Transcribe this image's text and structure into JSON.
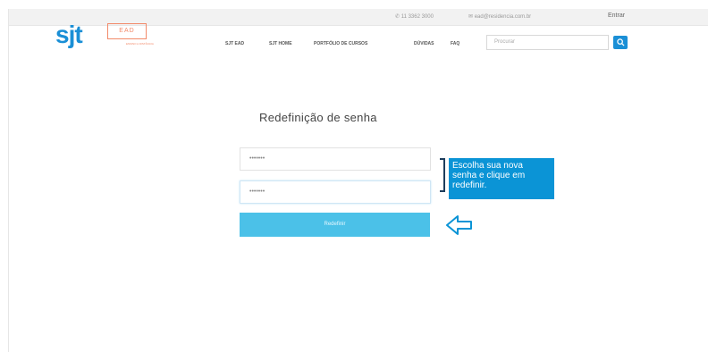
{
  "topbar": {
    "phone": "11 3362 3000",
    "email": "ead@residencia.com.br",
    "login": "Entrar"
  },
  "header": {
    "logo": "sjt",
    "ead_label": "EAD",
    "ead_tagline": "ENSINO A DISTÂNCIA",
    "nav": [
      "SJT EAD",
      "SJT HOME",
      "PORTFÓLIO DE CURSOS",
      "DÚVIDAS",
      "FAQ"
    ],
    "search_placeholder": "Procurar"
  },
  "form": {
    "title": "Redefinição de senha",
    "password_value": "•••••••",
    "confirm_value": "•••••••",
    "submit_label": "Redefinir"
  },
  "annotation": {
    "lines": [
      "Escolha sua nova",
      "senha e clique em",
      "redefinir."
    ]
  },
  "colors": {
    "brand_blue": "#1a8fd6",
    "ead_orange": "#f28a6a",
    "button": "#4bc1e8",
    "callout": "#0b94d6"
  }
}
